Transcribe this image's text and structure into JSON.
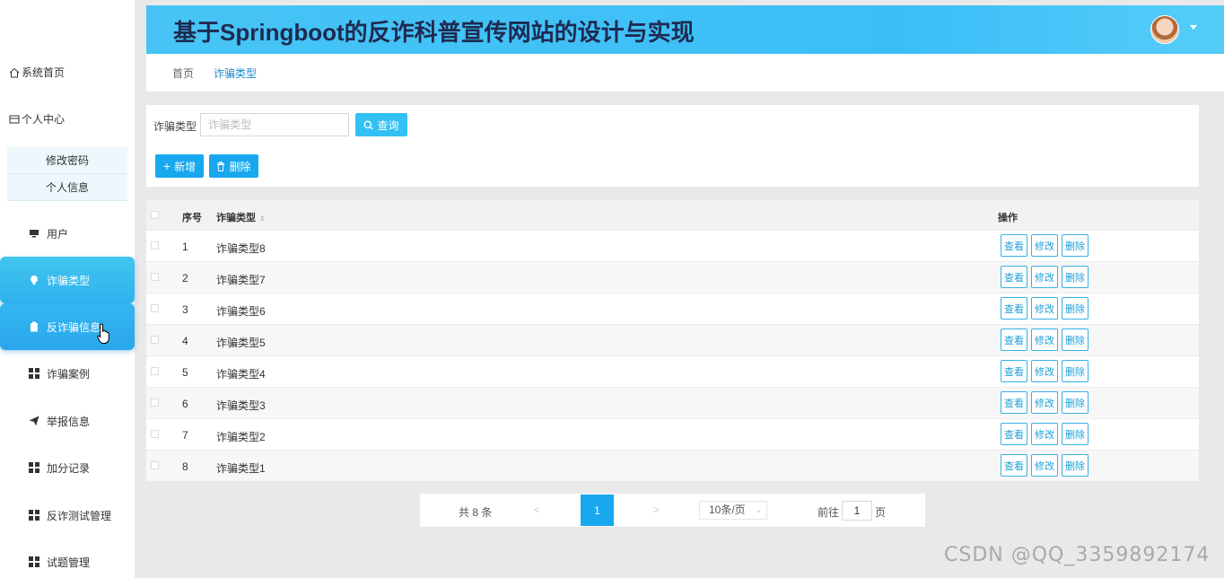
{
  "app": {
    "title": "基于Springboot的反诈科普宣传网站的设计与实现"
  },
  "sidebar": {
    "top_items": [
      {
        "label": "系统首页",
        "icon": "home-icon"
      },
      {
        "label": "个人中心",
        "icon": "card-icon"
      }
    ],
    "sub_items": [
      {
        "label": "修改密码"
      },
      {
        "label": "个人信息"
      }
    ],
    "items": [
      {
        "label": "用户",
        "icon": "monitor-icon"
      },
      {
        "label": "诈骗类型",
        "icon": "bulb-icon",
        "state": "active"
      },
      {
        "label": "反诈骗信息",
        "icon": "clipboard-icon",
        "state": "hover"
      },
      {
        "label": "诈骗案例",
        "icon": "grid-icon"
      },
      {
        "label": "举报信息",
        "icon": "send-icon"
      },
      {
        "label": "加分记录",
        "icon": "grid-icon"
      },
      {
        "label": "反诈测试管理",
        "icon": "grid-icon"
      },
      {
        "label": "试题管理",
        "icon": "grid-icon"
      }
    ]
  },
  "breadcrumb": {
    "home": "首页",
    "current": "诈骗类型"
  },
  "search": {
    "label": "诈骗类型",
    "placeholder": "诈骗类型",
    "query_label": "查询",
    "add_label": "新增",
    "delete_label": "删除"
  },
  "table": {
    "headers": {
      "index": "序号",
      "name": "诈骗类型",
      "ops": "操作"
    },
    "rows": [
      {
        "index": "1",
        "name": "诈骗类型8"
      },
      {
        "index": "2",
        "name": "诈骗类型7"
      },
      {
        "index": "3",
        "name": "诈骗类型6"
      },
      {
        "index": "4",
        "name": "诈骗类型5"
      },
      {
        "index": "5",
        "name": "诈骗类型4"
      },
      {
        "index": "6",
        "name": "诈骗类型3"
      },
      {
        "index": "7",
        "name": "诈骗类型2"
      },
      {
        "index": "8",
        "name": "诈骗类型1"
      }
    ],
    "op_labels": {
      "view": "查看",
      "edit": "修改",
      "delete": "删除"
    }
  },
  "pagination": {
    "total": "共 8 条",
    "prev": "<",
    "current": "1",
    "next": ">",
    "page_size": "10条/页",
    "goto_label": "前往",
    "goto_value": "1",
    "page_suffix": "页"
  },
  "watermark": "CSDN @QQ_3359892174",
  "colors": {
    "accent": "#18a8ee",
    "header": "#3bbef7",
    "title": "#1e2a50"
  }
}
